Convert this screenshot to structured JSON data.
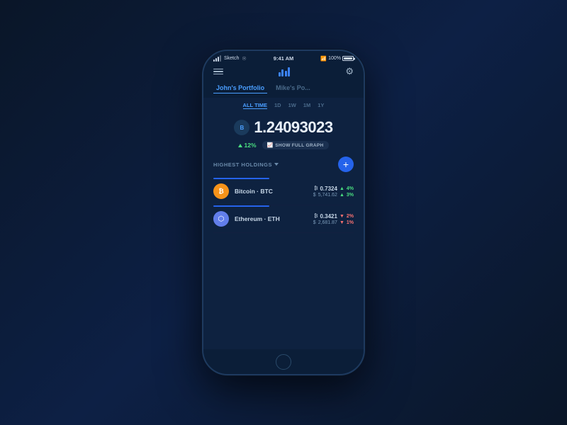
{
  "phone": {
    "status": {
      "carrier": "Sketch",
      "time": "9:41 AM",
      "bluetooth": "⬡",
      "battery_pct": "100%"
    },
    "nav": {
      "chart_label": "chart-icon",
      "gear_label": "⚙"
    },
    "portfolios": [
      {
        "id": "johns",
        "label": "John's Portfolio",
        "active": true
      },
      {
        "id": "mikes",
        "label": "Mike's Po...",
        "active": false
      }
    ],
    "time_ranges": [
      {
        "id": "all",
        "label": "ALL TIME",
        "active": true
      },
      {
        "id": "1d",
        "label": "1D",
        "active": false
      },
      {
        "id": "1w",
        "label": "1W",
        "active": false
      },
      {
        "id": "1m",
        "label": "1M",
        "active": false
      },
      {
        "id": "1y",
        "label": "1Y",
        "active": false
      }
    ],
    "balance": {
      "symbol": "B",
      "value": "1.24093023",
      "change_pct": "12%",
      "change_label": "SHOW FULL GRAPH"
    },
    "holdings": {
      "title": "HIGHEST HOLDINGS",
      "add_button": "+",
      "coins": [
        {
          "id": "btc",
          "name": "Bitcoin · BTC",
          "logo": "₿",
          "amount_symbol": "₿",
          "amount": "0.7324",
          "amount_change": "4%",
          "amount_change_dir": "up",
          "usd_value": "5,741.62",
          "usd_change": "3%",
          "usd_change_dir": "up"
        },
        {
          "id": "eth",
          "name": "Ethereum · ETH",
          "logo": "⟠",
          "amount_symbol": "₿",
          "amount": "0.3421",
          "amount_change": "2%",
          "amount_change_dir": "down",
          "usd_value": "2,681.87",
          "usd_change": "1%",
          "usd_change_dir": "down"
        }
      ]
    }
  }
}
